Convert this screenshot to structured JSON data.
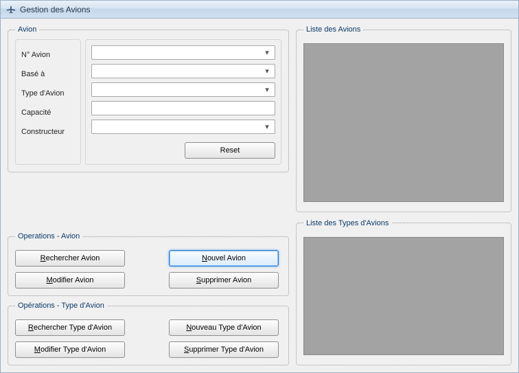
{
  "title": "Gestion des Avions",
  "avion": {
    "legend": "Avion",
    "labels": {
      "num": "N° Avion",
      "base": "Basé à",
      "type": "Type d'Avion",
      "capacite": "Capacité",
      "constructeur": "Constructeur"
    },
    "values": {
      "num": "",
      "base": "",
      "type": "",
      "capacite": "",
      "constructeur": ""
    },
    "reset": "Reset"
  },
  "ops_avion": {
    "legend": "Operations - Avion",
    "buttons": {
      "rechercher": {
        "pre": "",
        "u": "R",
        "post": "echercher Avion"
      },
      "nouvel": {
        "pre": "",
        "u": "N",
        "post": "ouvel Avion"
      },
      "modifier": {
        "pre": "",
        "u": "M",
        "post": "odifier Avion"
      },
      "supprimer": {
        "pre": "",
        "u": "S",
        "post": "upprimer Avion"
      }
    }
  },
  "ops_type": {
    "legend": "Opérations - Type d'Avion",
    "buttons": {
      "rechercher": {
        "pre": "",
        "u": "R",
        "post": "echercher Type d'Avion"
      },
      "nouveau": {
        "pre": "",
        "u": "N",
        "post": "ouveau Type d'Avion"
      },
      "modifier": {
        "pre": "",
        "u": "M",
        "post": "odifier Type d'Avion"
      },
      "supprimer": {
        "pre": "",
        "u": "S",
        "post": "upprimer Type d'Avion"
      }
    }
  },
  "lists": {
    "avions_legend": "Liste des Avions",
    "types_legend": "Liste des Types d'Avions"
  }
}
